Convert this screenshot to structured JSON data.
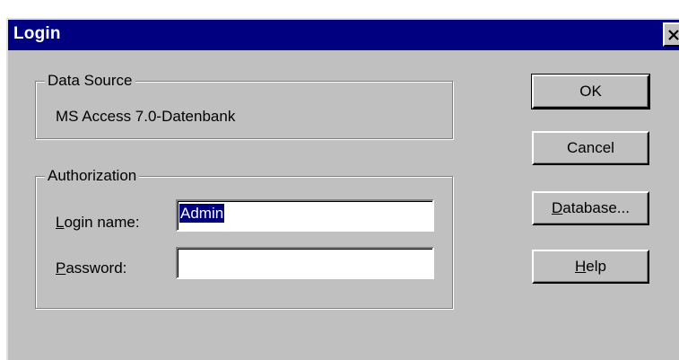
{
  "window": {
    "title": "Login",
    "close_icon": "close-icon"
  },
  "data_source": {
    "legend": "Data Source",
    "value": "MS Access 7.0-Datenbank"
  },
  "authorization": {
    "legend": "Authorization",
    "login_name": {
      "mnemonic": "L",
      "label_rest": "ogin name:",
      "value": "Admin"
    },
    "password": {
      "mnemonic": "P",
      "label_rest": "assword:",
      "value": ""
    }
  },
  "buttons": {
    "ok": "OK",
    "cancel": "Cancel",
    "database": {
      "mnemonic": "D",
      "rest": "atabase..."
    },
    "help": {
      "mnemonic": "H",
      "rest": "elp"
    }
  },
  "colors": {
    "title_bar": "#000080",
    "face": "#c0c0c0",
    "selection": "#000080"
  }
}
